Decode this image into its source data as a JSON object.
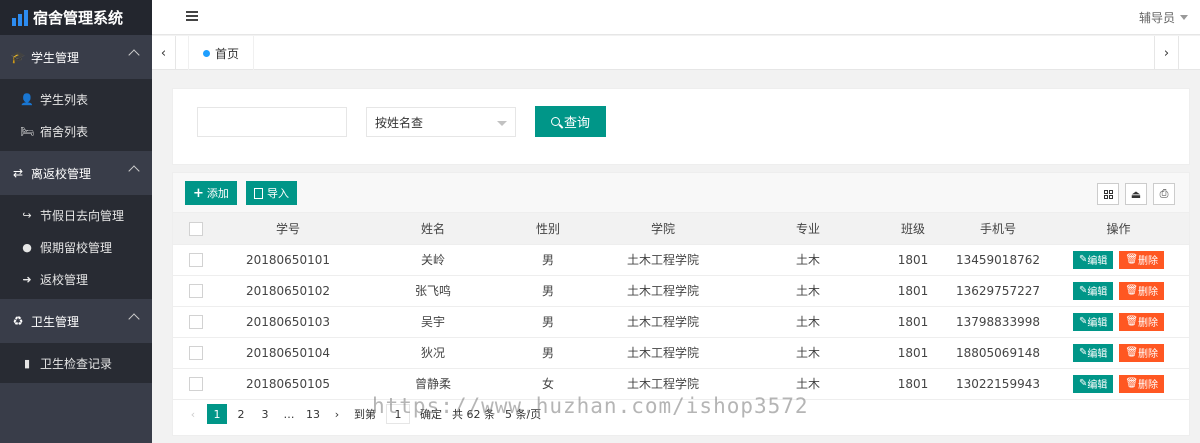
{
  "app": {
    "title": "宿舍管理系统"
  },
  "sidebar": {
    "groups": [
      {
        "label": "学生管理",
        "items": [
          {
            "label": "学生列表"
          },
          {
            "label": "宿舍列表"
          }
        ]
      },
      {
        "label": "离返校管理",
        "items": [
          {
            "label": "节假日去向管理"
          },
          {
            "label": "假期留校管理"
          },
          {
            "label": "返校管理"
          }
        ]
      },
      {
        "label": "卫生管理",
        "items": [
          {
            "label": "卫生检查记录"
          }
        ]
      }
    ]
  },
  "header": {
    "user_label": "辅导员"
  },
  "tabs": {
    "home_label": "首页"
  },
  "search": {
    "input_value": "",
    "select_value": "按姓名查",
    "query_label": "查询"
  },
  "toolbar": {
    "add_label": "添加",
    "import_label": "导入"
  },
  "table": {
    "columns": [
      "学号",
      "姓名",
      "性别",
      "学院",
      "专业",
      "班级",
      "手机号",
      "操作"
    ],
    "rows": [
      [
        "20180650101",
        "关岭",
        "男",
        "土木工程学院",
        "土木",
        "1801",
        "13459018762"
      ],
      [
        "20180650102",
        "张飞鸣",
        "男",
        "土木工程学院",
        "土木",
        "1801",
        "13629757227"
      ],
      [
        "20180650103",
        "吴宇",
        "男",
        "土木工程学院",
        "土木",
        "1801",
        "13798833998"
      ],
      [
        "20180650104",
        "狄况",
        "男",
        "土木工程学院",
        "土木",
        "1801",
        "18805069148"
      ],
      [
        "20180650105",
        "曾静柔",
        "女",
        "土木工程学院",
        "土木",
        "1801",
        "13022159943"
      ]
    ],
    "edit_label": "编辑",
    "delete_label": "删除"
  },
  "pagination": {
    "pages": [
      "1",
      "2",
      "3",
      "…",
      "13"
    ],
    "current": "1",
    "goto_label": "到第",
    "goto_value": "1",
    "confirm_label": "确定",
    "total_label": "共 62 条",
    "page_size_label": "5 条/页"
  },
  "watermark": "https://www.huzhan.com/ishop3572"
}
